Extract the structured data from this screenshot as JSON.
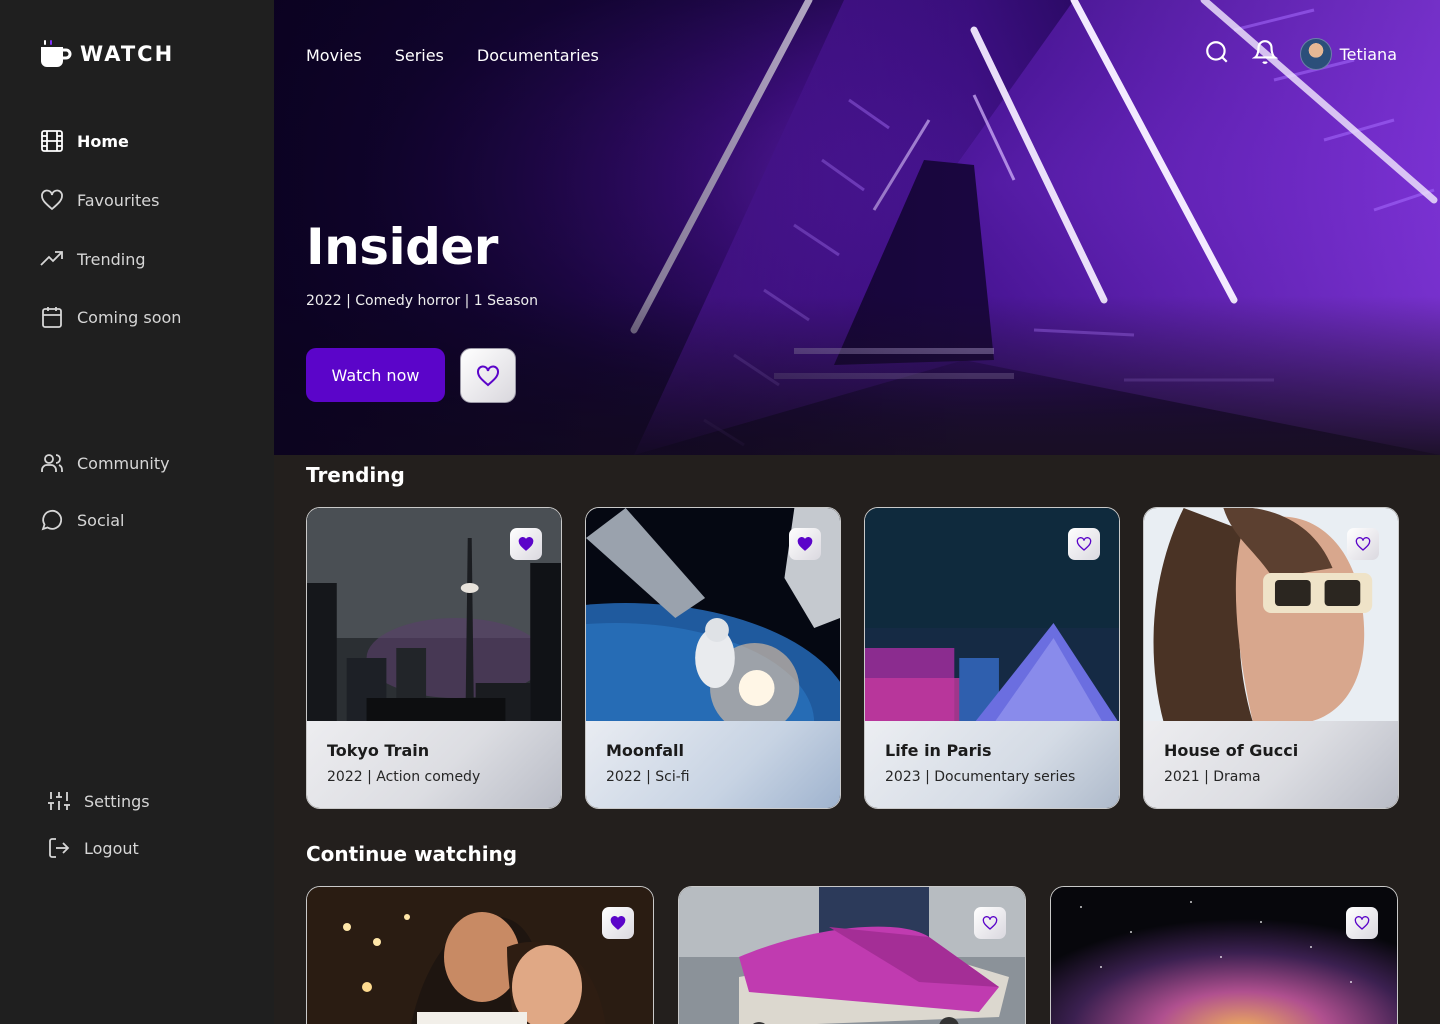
{
  "app": {
    "name": "WATCH"
  },
  "sidebar": {
    "primary": [
      {
        "label": "Home",
        "icon": "film-icon",
        "active": true
      },
      {
        "label": "Favourites",
        "icon": "heart-icon"
      },
      {
        "label": "Trending",
        "icon": "trending-icon"
      },
      {
        "label": "Coming soon",
        "icon": "calendar-icon"
      }
    ],
    "social": [
      {
        "label": "Community",
        "icon": "users-icon"
      },
      {
        "label": "Social",
        "icon": "chat-icon"
      }
    ],
    "footer": [
      {
        "label": "Settings",
        "icon": "sliders-icon"
      },
      {
        "label": "Logout",
        "icon": "logout-icon"
      }
    ]
  },
  "topnav": {
    "links": [
      "Movies",
      "Series",
      "Documentaries"
    ]
  },
  "user": {
    "name": "Tetiana"
  },
  "hero": {
    "title": "Insider",
    "meta": "2022 | Comedy horror | 1 Season",
    "watch_label": "Watch now"
  },
  "trending": {
    "title": "Trending",
    "items": [
      {
        "title": "Tokyo Train",
        "meta": "2022 | Action comedy",
        "favourited": true
      },
      {
        "title": "Moonfall",
        "meta": "2022 | Sci-fi",
        "favourited": true
      },
      {
        "title": "Life in Paris",
        "meta": "2023 | Documentary series",
        "favourited": false
      },
      {
        "title": "House of Gucci",
        "meta": "2021 | Drama",
        "favourited": false
      }
    ]
  },
  "continue_watching": {
    "title": "Continue watching",
    "items": [
      {
        "favourited": true
      },
      {
        "favourited": false
      },
      {
        "favourited": false
      }
    ]
  },
  "colors": {
    "accent": "#5b05c9",
    "sidebar": "#1f1f1f",
    "background": "#231f1d"
  }
}
